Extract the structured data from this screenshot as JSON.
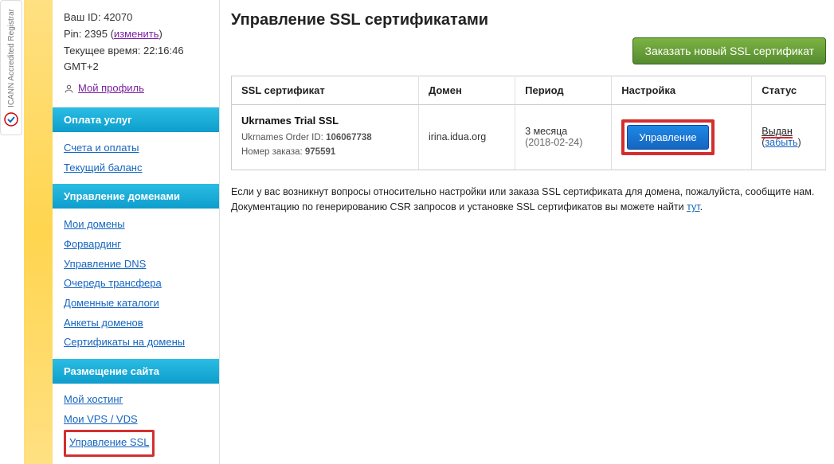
{
  "badge": {
    "label": "ICANN Accredited Registrar"
  },
  "sidebar": {
    "info": {
      "id_label": "Ваш ID:",
      "id_value": "42070",
      "pin_label": "Pin:",
      "pin_value": "2395",
      "pin_change": "изменить",
      "time_label": "Текущее время:",
      "time_value": "22:16:46 GMT+2",
      "profile": "Мой профиль"
    },
    "sections": [
      {
        "title": "Оплата услуг",
        "links": [
          "Счета и оплаты",
          "Текущий баланс"
        ]
      },
      {
        "title": "Управление доменами",
        "links": [
          "Мои домены",
          "Форвардинг",
          "Управление DNS",
          "Очередь трансфера",
          "Доменные каталоги",
          "Анкеты доменов",
          "Сертификаты на домены"
        ]
      },
      {
        "title": "Размещение сайта",
        "links": [
          "Мой хостинг",
          "Мои VPS / VDS",
          "Управление SSL"
        ]
      }
    ]
  },
  "main": {
    "title": "Управление SSL сертификатами",
    "order_button": "Заказать новый SSL сертификат",
    "headers": [
      "SSL сертификат",
      "Домен",
      "Период",
      "Настройка",
      "Статус"
    ],
    "row": {
      "cert_name": "Ukrnames Trial SSL",
      "order_label": "Ukrnames Order ID:",
      "order_id": "106067738",
      "num_label": "Номер заказа:",
      "num_value": "975591",
      "domain": "irina.idua.org",
      "period": "3 месяца",
      "period_date": "(2018-02-24)",
      "manage": "Управление",
      "status": "Выдан",
      "forget": "забыть"
    },
    "footnote_text": "Если у вас возникнут вопросы относительно настройки или заказа SSL сертификата для домена, пожалуйста, сообщите нам. Документацию по генерированию CSR запросов и установке SSL сертификатов вы можете найти ",
    "footnote_link": "тут"
  }
}
